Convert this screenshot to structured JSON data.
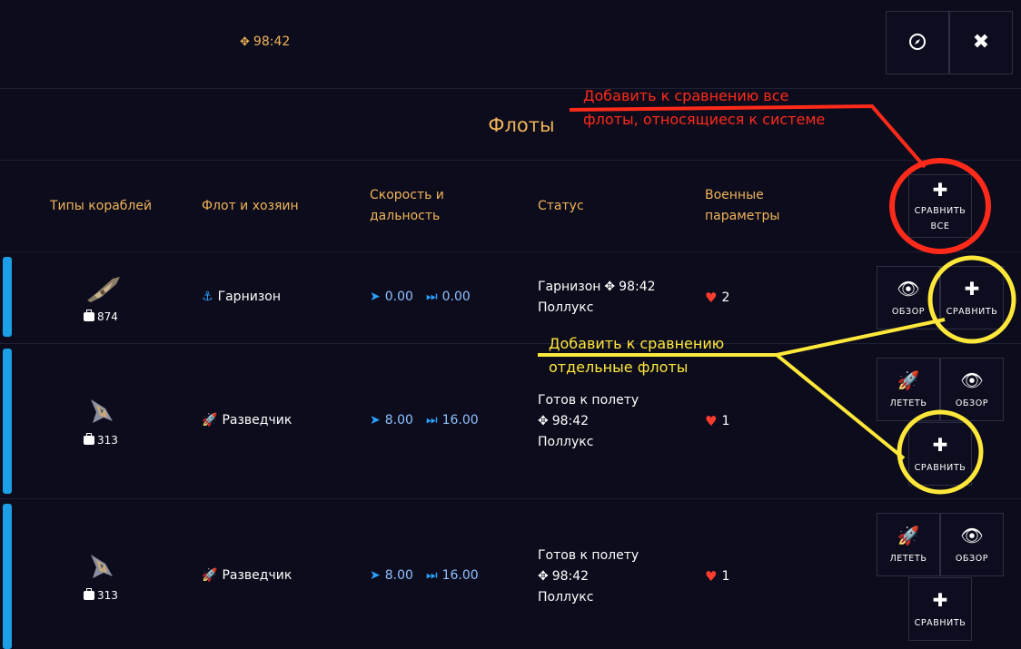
{
  "topbar": {
    "coord": "98:42",
    "compass_icon": "compass-icon",
    "close_icon": "close-icon"
  },
  "section": {
    "title": "Флоты"
  },
  "columns": {
    "ship_types": "Типы кораблей",
    "fleet_owner": "Флот и хозяин",
    "speed_line1": "Скорость и",
    "speed_line2": "дальность",
    "status": "Статус",
    "military_line1": "Военные",
    "military_line2": "параметры",
    "compare_all_line1": "СРАВНИТЬ",
    "compare_all_line2": "ВСЕ"
  },
  "buttons": {
    "view": "ОБЗОР",
    "compare": "СРАВНИТЬ",
    "fly": "ЛЕТЕТЬ"
  },
  "fleets": [
    {
      "cargo": "874",
      "owner": "Гарнизон",
      "owner_icon": "anchor-icon",
      "speed": "0.00",
      "range": "0.00",
      "status_line1": "Гарнизон",
      "status_coord": "98:42",
      "status_line3": "Поллукс",
      "military": "2"
    },
    {
      "cargo": "313",
      "owner": "Разведчик",
      "owner_icon": "rocket-icon",
      "speed": "8.00",
      "range": "16.00",
      "status_line1": "Готов к полету",
      "status_coord": "98:42",
      "status_line3": "Поллукс",
      "military": "1"
    },
    {
      "cargo": "313",
      "owner": "Разведчик",
      "owner_icon": "rocket-icon",
      "speed": "8.00",
      "range": "16.00",
      "status_line1": "Готов к полету",
      "status_coord": "98:42",
      "status_line3": "Поллукс",
      "military": "1"
    }
  ],
  "annotations": {
    "red_line1": "Добавить к сравнению все",
    "red_line2": "флоты, относящиеся к системе",
    "yellow_line1": "Добавить к сравнению",
    "yellow_line2": "отдельные флоты"
  },
  "colors": {
    "background": "#0c0c1c",
    "accent_orange": "#f0b45a",
    "row_bar_blue": "#1c9fe6",
    "annotation_red": "#ff2a1a",
    "annotation_yellow": "#ffe83a",
    "heart_red": "#ff3d2e"
  }
}
